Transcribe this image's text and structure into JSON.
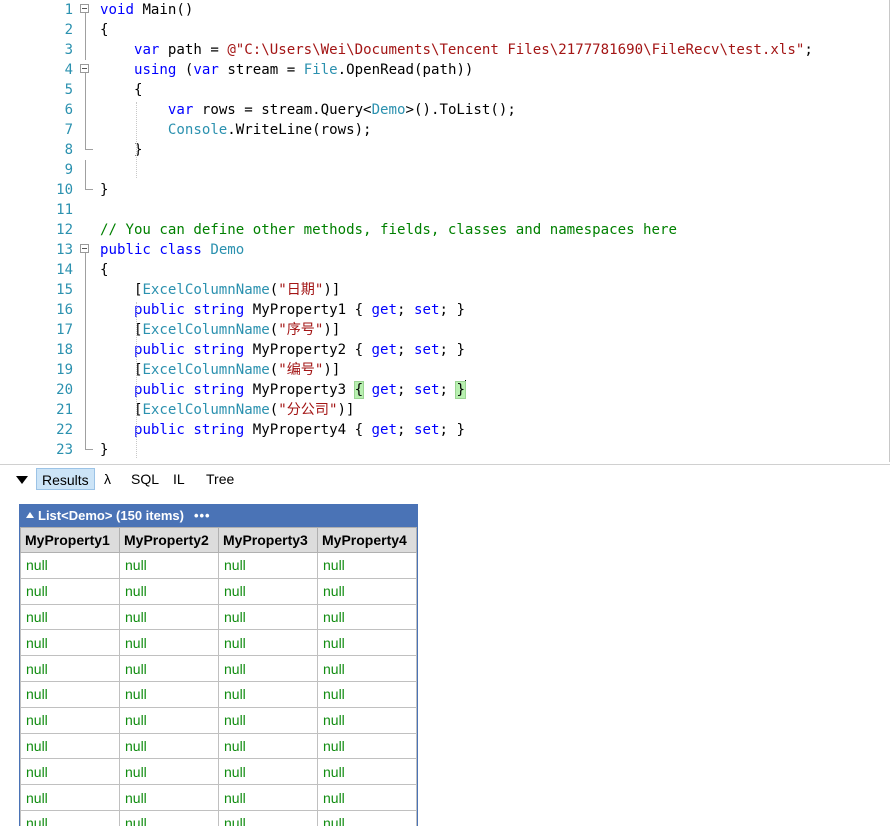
{
  "editor": {
    "lines": [
      {
        "n": "1",
        "fold": "box",
        "tokens": [
          [
            "kw",
            "void"
          ],
          [
            "plain",
            " Main()"
          ]
        ]
      },
      {
        "n": "2",
        "fold": "line",
        "tokens": [
          [
            "plain",
            "{"
          ]
        ]
      },
      {
        "n": "3",
        "fold": "line",
        "tokens": [
          [
            "plain",
            "    "
          ],
          [
            "kw",
            "var"
          ],
          [
            "plain",
            " path = "
          ],
          [
            "str",
            "@\"C:\\Users\\Wei\\Documents\\Tencent Files\\2177781690\\FileRecv\\test.xls\""
          ],
          [
            "plain",
            ";"
          ]
        ]
      },
      {
        "n": "4",
        "fold": "box",
        "tokens": [
          [
            "plain",
            "    "
          ],
          [
            "kw",
            "using"
          ],
          [
            "plain",
            " ("
          ],
          [
            "kw",
            "var"
          ],
          [
            "plain",
            " stream = "
          ],
          [
            "type",
            "File"
          ],
          [
            "plain",
            ".OpenRead(path))"
          ]
        ]
      },
      {
        "n": "5",
        "fold": "line",
        "tokens": [
          [
            "plain",
            "    {"
          ]
        ]
      },
      {
        "n": "6",
        "fold": "line",
        "tokens": [
          [
            "plain",
            "        "
          ],
          [
            "kw",
            "var"
          ],
          [
            "plain",
            " rows = stream.Query<"
          ],
          [
            "type",
            "Demo"
          ],
          [
            "plain",
            ">().ToList();"
          ]
        ]
      },
      {
        "n": "7",
        "fold": "line",
        "tokens": [
          [
            "plain",
            "        "
          ],
          [
            "type",
            "Console"
          ],
          [
            "plain",
            ".WriteLine(rows);"
          ]
        ]
      },
      {
        "n": "8",
        "fold": "end",
        "tokens": [
          [
            "plain",
            "    }"
          ]
        ]
      },
      {
        "n": "9",
        "fold": "line",
        "tokens": []
      },
      {
        "n": "10",
        "fold": "end",
        "tokens": [
          [
            "plain",
            "}"
          ]
        ]
      },
      {
        "n": "11",
        "fold": "none",
        "tokens": []
      },
      {
        "n": "12",
        "fold": "none",
        "tokens": [
          [
            "com",
            "// You can define other methods, fields, classes and namespaces here"
          ]
        ]
      },
      {
        "n": "13",
        "fold": "box",
        "tokens": [
          [
            "kw",
            "public class"
          ],
          [
            "plain",
            " "
          ],
          [
            "type",
            "Demo"
          ]
        ]
      },
      {
        "n": "14",
        "fold": "line",
        "tokens": [
          [
            "plain",
            "{"
          ]
        ]
      },
      {
        "n": "15",
        "fold": "line",
        "tokens": [
          [
            "plain",
            "    ["
          ],
          [
            "type",
            "ExcelColumnName"
          ],
          [
            "plain",
            "("
          ],
          [
            "str",
            "\"日期\""
          ],
          [
            "plain",
            ")]"
          ]
        ]
      },
      {
        "n": "16",
        "fold": "line",
        "tokens": [
          [
            "plain",
            "    "
          ],
          [
            "kw",
            "public string"
          ],
          [
            "plain",
            " MyProperty1 { "
          ],
          [
            "kw",
            "get"
          ],
          [
            "plain",
            "; "
          ],
          [
            "kw",
            "set"
          ],
          [
            "plain",
            "; }"
          ]
        ]
      },
      {
        "n": "17",
        "fold": "line",
        "tokens": [
          [
            "plain",
            "    ["
          ],
          [
            "type",
            "ExcelColumnName"
          ],
          [
            "plain",
            "("
          ],
          [
            "str",
            "\"序号\""
          ],
          [
            "plain",
            ")]"
          ]
        ]
      },
      {
        "n": "18",
        "fold": "line",
        "tokens": [
          [
            "plain",
            "    "
          ],
          [
            "kw",
            "public string"
          ],
          [
            "plain",
            " MyProperty2 { "
          ],
          [
            "kw",
            "get"
          ],
          [
            "plain",
            "; "
          ],
          [
            "kw",
            "set"
          ],
          [
            "plain",
            "; }"
          ]
        ]
      },
      {
        "n": "19",
        "fold": "line",
        "tokens": [
          [
            "plain",
            "    ["
          ],
          [
            "type",
            "ExcelColumnName"
          ],
          [
            "plain",
            "("
          ],
          [
            "str",
            "\"编号\""
          ],
          [
            "plain",
            ")]"
          ]
        ]
      },
      {
        "n": "20",
        "fold": "line",
        "tokens": [
          [
            "plain",
            "    "
          ],
          [
            "kw",
            "public string"
          ],
          [
            "plain",
            " MyProperty3 "
          ],
          [
            "hl",
            "{"
          ],
          [
            "plain",
            " "
          ],
          [
            "kw",
            "get"
          ],
          [
            "plain",
            "; "
          ],
          [
            "kw",
            "set"
          ],
          [
            "plain",
            "; "
          ],
          [
            "hl",
            "}"
          ],
          [
            "caret",
            ""
          ]
        ]
      },
      {
        "n": "21",
        "fold": "line",
        "tokens": [
          [
            "plain",
            "    ["
          ],
          [
            "type",
            "ExcelColumnName"
          ],
          [
            "plain",
            "("
          ],
          [
            "str",
            "\"分公司\""
          ],
          [
            "plain",
            ")]"
          ]
        ]
      },
      {
        "n": "22",
        "fold": "line",
        "tokens": [
          [
            "plain",
            "    "
          ],
          [
            "kw",
            "public string"
          ],
          [
            "plain",
            " MyProperty4 { "
          ],
          [
            "kw",
            "get"
          ],
          [
            "plain",
            "; "
          ],
          [
            "kw",
            "set"
          ],
          [
            "plain",
            "; }"
          ]
        ]
      },
      {
        "n": "23",
        "fold": "end",
        "tokens": [
          [
            "plain",
            "}"
          ]
        ]
      }
    ]
  },
  "results_tabs": {
    "collapse_icon": "triangle-down-icon",
    "tabs": [
      {
        "label": "Results",
        "active": true
      },
      {
        "label": "λ",
        "active": false
      },
      {
        "label": "SQL",
        "active": false
      },
      {
        "label": "IL",
        "active": false
      },
      {
        "label": "Tree",
        "active": false
      }
    ]
  },
  "result_list": {
    "title": "List<Demo> (150 items)",
    "menu": "•••",
    "columns": [
      "MyProperty1",
      "MyProperty2",
      "MyProperty3",
      "MyProperty4"
    ],
    "rows": [
      [
        "null",
        "null",
        "null",
        "null"
      ],
      [
        "null",
        "null",
        "null",
        "null"
      ],
      [
        "null",
        "null",
        "null",
        "null"
      ],
      [
        "null",
        "null",
        "null",
        "null"
      ],
      [
        "null",
        "null",
        "null",
        "null"
      ],
      [
        "null",
        "null",
        "null",
        "null"
      ],
      [
        "null",
        "null",
        "null",
        "null"
      ],
      [
        "null",
        "null",
        "null",
        "null"
      ],
      [
        "null",
        "null",
        "null",
        "null"
      ],
      [
        "null",
        "null",
        "null",
        "null"
      ],
      [
        "null",
        "null",
        "null",
        "null"
      ]
    ]
  },
  "colors": {
    "keyword": "#0000ff",
    "type": "#2b91af",
    "string": "#a31515",
    "comment": "#008000",
    "line_number": "#2b91af",
    "null_value": "#108c10",
    "list_header": "#4a73b6"
  }
}
